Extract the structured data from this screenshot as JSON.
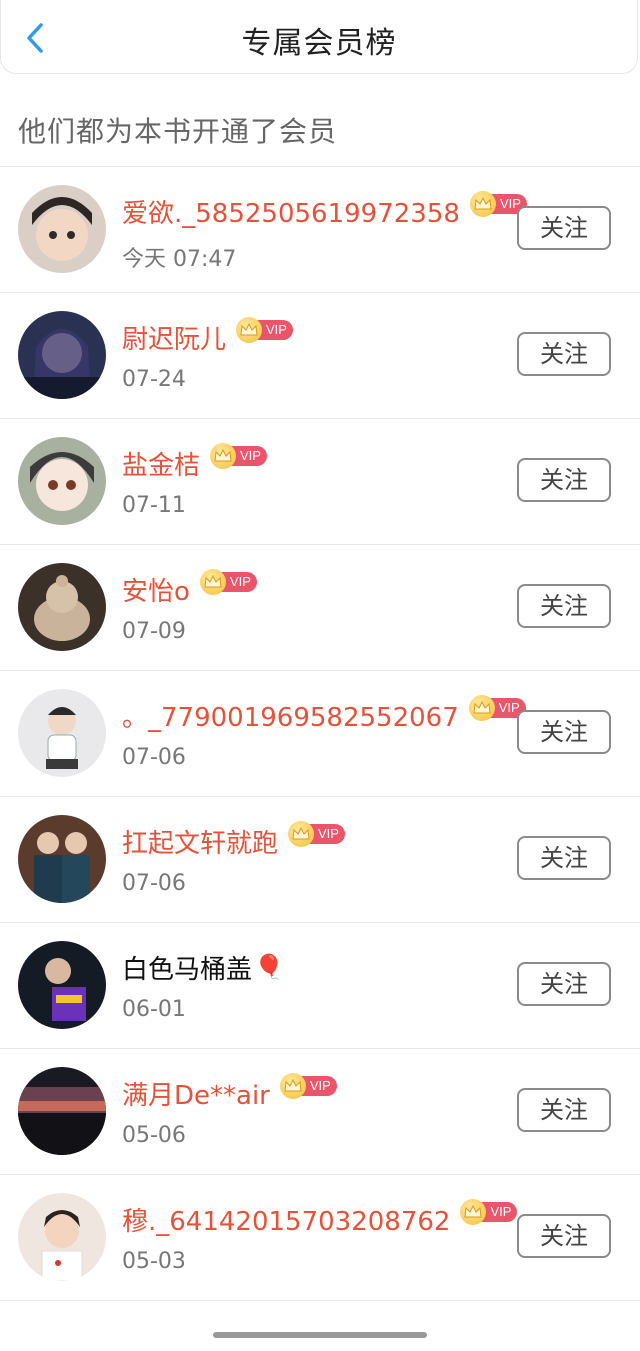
{
  "header": {
    "title": "专属会员榜",
    "back_icon": "chevron-left-icon"
  },
  "subtitle": "他们都为本书开通了会员",
  "vip_label": "VIP",
  "follow_label": "关注",
  "colors": {
    "name_red": "#e5523a",
    "vip_pink": "#e9556a",
    "back_blue": "#2f9be8"
  },
  "members": [
    {
      "name": "爱欲._5852505619972358",
      "date": "今天 07:47",
      "vip": true
    },
    {
      "name": "尉迟阮儿",
      "date": "07-24",
      "vip": true
    },
    {
      "name": "盐金桔",
      "date": "07-11",
      "vip": true
    },
    {
      "name": "安怡o",
      "date": "07-09",
      "vip": true
    },
    {
      "name": "。_779001969582552067",
      "date": "07-06",
      "vip": true
    },
    {
      "name": "扛起文轩就跑",
      "date": "07-06",
      "vip": true
    },
    {
      "name": "白色马桶盖",
      "date": "06-01",
      "vip": false,
      "emoji": "🎈"
    },
    {
      "name": "满月De**air",
      "date": "05-06",
      "vip": true
    },
    {
      "name": "穆._64142015703208762",
      "date": "05-03",
      "vip": true
    }
  ]
}
